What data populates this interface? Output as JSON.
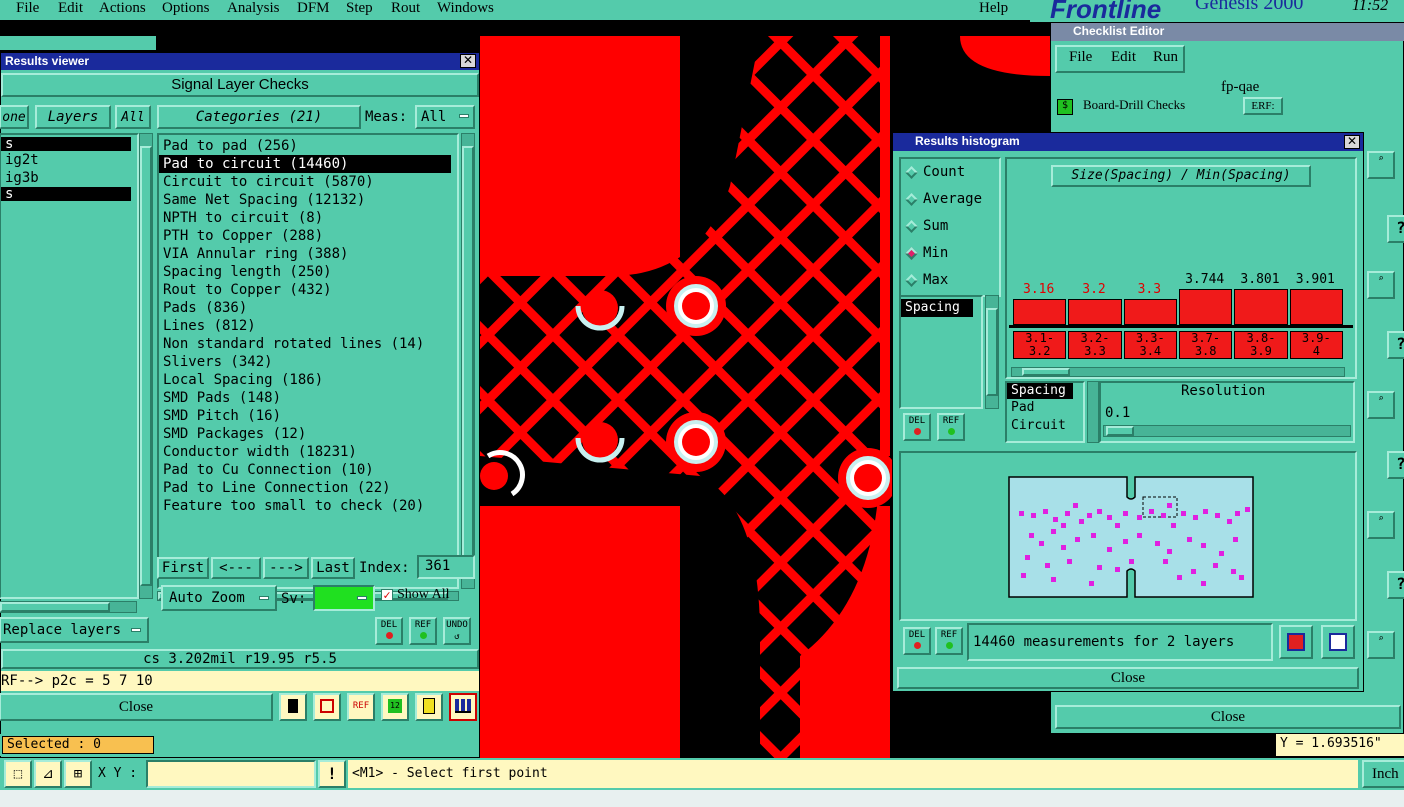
{
  "menubar": {
    "items": [
      "File",
      "Edit",
      "Actions",
      "Options",
      "Analysis",
      "DFM",
      "Step",
      "Rout",
      "Windows"
    ],
    "help": "Help",
    "brand": "Frontline",
    "product": "Genesis 2000",
    "time": "11:52"
  },
  "results_viewer": {
    "title": "Results viewer",
    "header": "Signal Layer Checks",
    "none_label": "one",
    "layers_label": "Layers",
    "all_label": "All",
    "layers": [
      "s",
      "ig2t",
      "ig3b",
      "s"
    ],
    "categories_label": "Categories (21)",
    "meas_label": "Meas:",
    "meas_value": "All",
    "categories": [
      "Pad to pad (256)",
      "Pad to circuit (14460)",
      "Circuit to circuit (5870)",
      "Same Net Spacing (12132)",
      "NPTH to circuit (8)",
      "PTH to Copper (288)",
      "VIA Annular ring (388)",
      "Spacing length (250)",
      "Rout to Copper (432)",
      "Pads (836)",
      "Lines (812)",
      "Non standard rotated lines (14)",
      "Slivers (342)",
      "Local Spacing (186)",
      "SMD Pads (148)",
      "SMD Pitch (16)",
      "SMD Packages (12)",
      "Conductor width (18231)",
      "Pad to Cu Connection (10)",
      "Pad to Line Connection (22)",
      "Feature too small to check (20)"
    ],
    "selected_category": "Pad to circuit (14460)",
    "nav": {
      "first": "First",
      "prev": "<---",
      "next": "--->",
      "last": "Last"
    },
    "index_label": "Index:",
    "index_value": "361",
    "auto_zoom": "Auto Zoom",
    "sv_label": "Sv:",
    "show_all": "Show All",
    "replace_layers": "Replace layers",
    "del": "DEL",
    "ref": "REF",
    "undo": "UNDO",
    "status": "cs 3.202mil  r19.95  r5.5",
    "ref_line": "RF--> p2c = 5 7 10",
    "close": "Close"
  },
  "histogram": {
    "title": "Results histogram",
    "options": [
      {
        "label": "Count",
        "selected": false
      },
      {
        "label": "Average",
        "selected": false
      },
      {
        "label": "Sum",
        "selected": false
      },
      {
        "label": "Min",
        "selected": true
      },
      {
        "label": "Max",
        "selected": false
      }
    ],
    "list_item": "Spacing",
    "chart_title": "Size(Spacing) / Min(Spacing)",
    "bars": [
      {
        "value": "3.16",
        "range_top": "3.1-",
        "range_bot": "3.2",
        "level": 0.68,
        "red": true
      },
      {
        "value": "3.2",
        "range_top": "3.2-",
        "range_bot": "3.3",
        "level": 0.68,
        "red": true
      },
      {
        "value": "3.3",
        "range_top": "3.3-",
        "range_bot": "3.4",
        "level": 0.68,
        "red": true
      },
      {
        "value": "3.744",
        "range_top": "3.7-",
        "range_bot": "3.8",
        "level": 0.82,
        "red": false
      },
      {
        "value": "3.801",
        "range_top": "3.8-",
        "range_bot": "3.9",
        "level": 0.82,
        "red": false
      },
      {
        "value": "3.901",
        "range_top": "3.9-",
        "range_bot": "4",
        "level": 0.82,
        "red": false
      }
    ],
    "measure_list": [
      "Spacing",
      "Pad",
      "Circuit"
    ],
    "resolution_label": "Resolution",
    "resolution_value": "0.1",
    "summary": "14460 measurements for 2 layers",
    "del": "DEL",
    "ref": "REF",
    "close": "Close"
  },
  "checklist": {
    "title": "Checklist Editor",
    "menu": [
      "File",
      "Edit",
      "Run"
    ],
    "name": "fp-qae",
    "row": "Board-Drill Checks",
    "row_tag": "ERF:",
    "close": "Close"
  },
  "bottom": {
    "selected": "Selected : 0",
    "xy_label": "X Y :",
    "xy_value": "",
    "prompt": "<M1> - Select first point",
    "y_readout": "Y = 1.693516\"",
    "units": "Inch"
  },
  "colors": {
    "panel": "#54cbab",
    "copper": "#ff0000",
    "title_bar": "#1a2a9c",
    "status_yellow": "#fff8c0"
  }
}
